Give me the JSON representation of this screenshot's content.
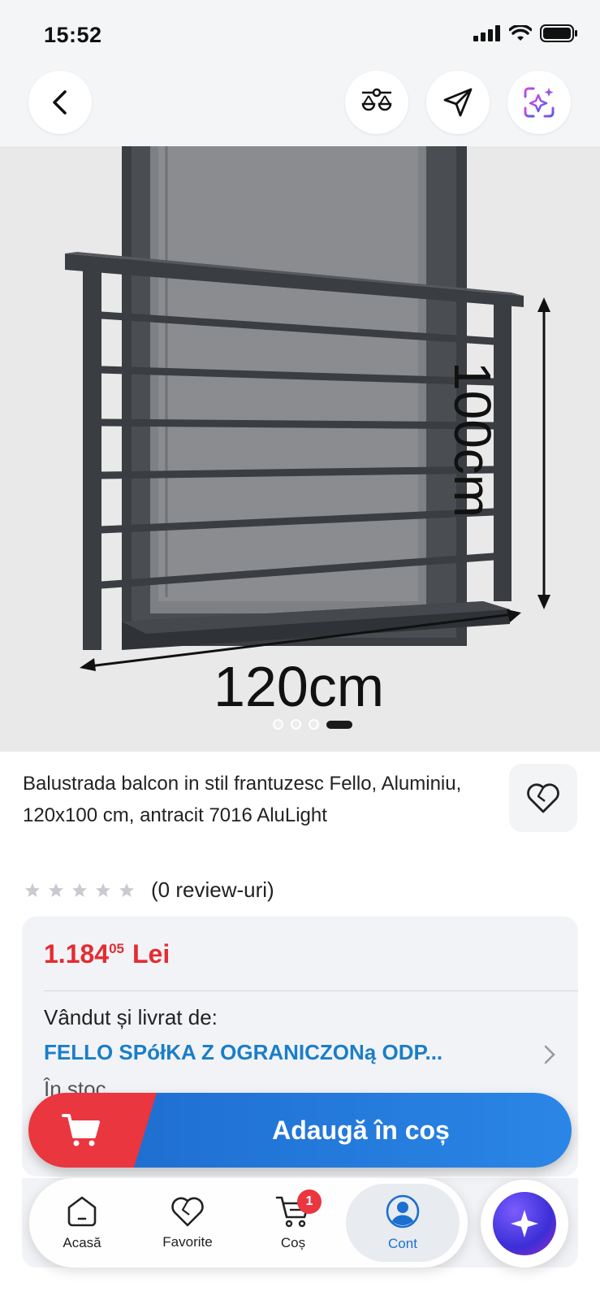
{
  "status": {
    "time": "15:52"
  },
  "product": {
    "title": "Balustrada balcon in stil frantuzesc Fello, Aluminiu, 120x100 cm, antracit 7016 AluLight",
    "image_labels": {
      "height": "100cm",
      "width": "120cm"
    },
    "carousel": {
      "count": 4,
      "active_index": 3
    },
    "rating": {
      "stars": 0,
      "max_stars": 5,
      "reviews_text": "(0 review-uri)"
    }
  },
  "price": {
    "integer": "1.184",
    "decimals": "05",
    "currency": "Lei",
    "sold_label": "Vândut și livrat de:",
    "seller": "FELLO SPółKA Z OGRANICZONą ODP...",
    "stock": "În stoc"
  },
  "cart": {
    "label": "Adaugă în coș"
  },
  "nav": {
    "items": [
      {
        "label": "Acasă",
        "icon": "home-icon"
      },
      {
        "label": "Favorite",
        "icon": "heart-icon"
      },
      {
        "label": "Coș",
        "icon": "cart-icon",
        "badge": "1"
      },
      {
        "label": "Cont",
        "icon": "account-icon",
        "active": true
      }
    ]
  },
  "colors": {
    "accent": "#1a6fd1",
    "price": "#e22d32",
    "cart_red": "#e9363f"
  }
}
